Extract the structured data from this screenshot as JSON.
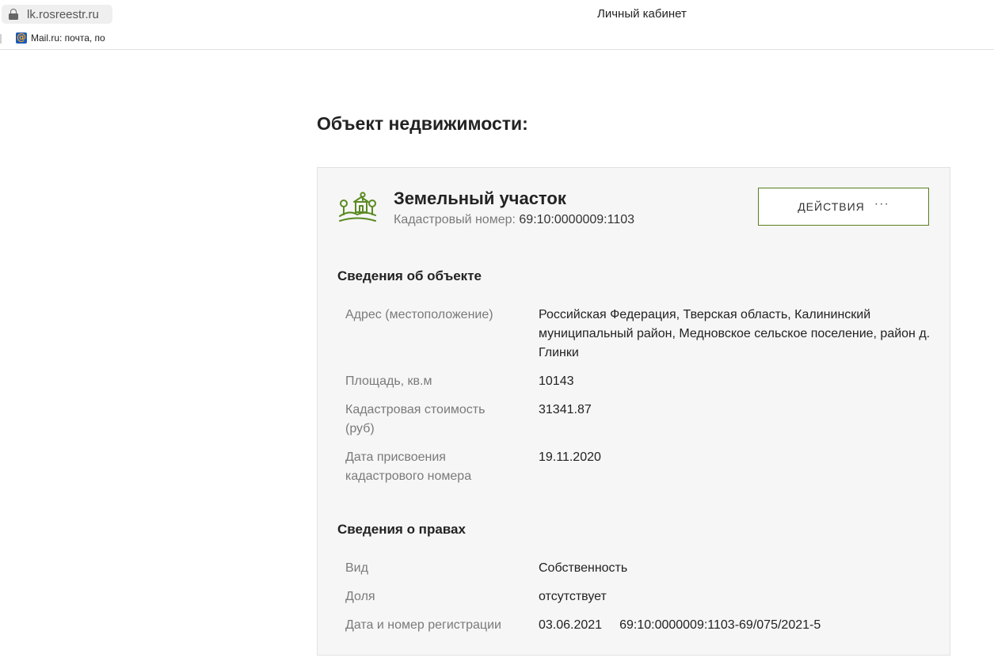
{
  "browser": {
    "url": "lk.rosreestr.ru",
    "window_title": "Личный кабинет",
    "bookmarks": [
      {
        "label": "Mail.ru: почта, по",
        "icon": "mailru-icon"
      }
    ]
  },
  "page": {
    "title": "Объект недвижимости:"
  },
  "object": {
    "icon": "land-plot-icon",
    "type": "Земельный участок",
    "cadastral_label": "Кадастровый номер:",
    "cadastral_number": "69:10:0000009:1103",
    "actions_label": "ДЕЙСТВИЯ",
    "actions_icon": "more-dots-icon"
  },
  "details": {
    "title": "Сведения об объекте",
    "address_label": "Адрес (местоположение)",
    "address_value": "Российская Федерация, Тверская область, Калининский муниципальный район, Медновское сельское поселение, район д. Глинки",
    "area_label": "Площадь, кв.м",
    "area_value": "10143",
    "cost_label": "Кадастровая стоимость (руб)",
    "cost_value": "31341.87",
    "date_label": "Дата присвоения кадастрового номера",
    "date_value": "19.11.2020"
  },
  "rights": {
    "title": "Сведения о правах",
    "kind_label": "Вид",
    "kind_value": "Собственность",
    "share_label": "Доля",
    "share_value": "отсутствует",
    "reg_label": "Дата и номер регистрации",
    "reg_date": "03.06.2021",
    "reg_number": "69:10:0000009:1103-69/075/2021-5"
  },
  "colors": {
    "accent_green": "#5a7d1e",
    "card_background": "#f6f6f6",
    "label_gray": "#7a7a7a"
  }
}
